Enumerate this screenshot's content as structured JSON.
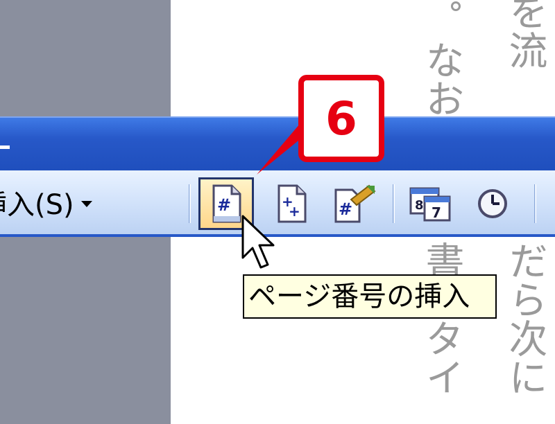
{
  "document": {
    "col1": "を流",
    "col2": "なお",
    "col2_lower": "書のタイ",
    "col3_lower": "だら次に"
  },
  "toolbar": {
    "insert_menu_label": "挿入(S)",
    "buttons": [
      {
        "name": "insert-page-number-button",
        "icon": "page-number-icon",
        "active": true
      },
      {
        "name": "insert-page-count-button",
        "icon": "page-count-icon",
        "active": false
      },
      {
        "name": "format-page-number-button",
        "icon": "format-page-number-icon",
        "active": false
      },
      {
        "name": "insert-date-button",
        "icon": "calendar-icon",
        "active": false
      },
      {
        "name": "insert-time-button",
        "icon": "clock-icon",
        "active": false
      }
    ]
  },
  "callout": {
    "number": "6",
    "color": "#e60012"
  },
  "tooltip": {
    "text": "ページ番号の挿入"
  },
  "colors": {
    "title_bar": "#2758c8",
    "side_panel": "#8a8f9e",
    "tooltip_bg": "#ffffe1"
  }
}
